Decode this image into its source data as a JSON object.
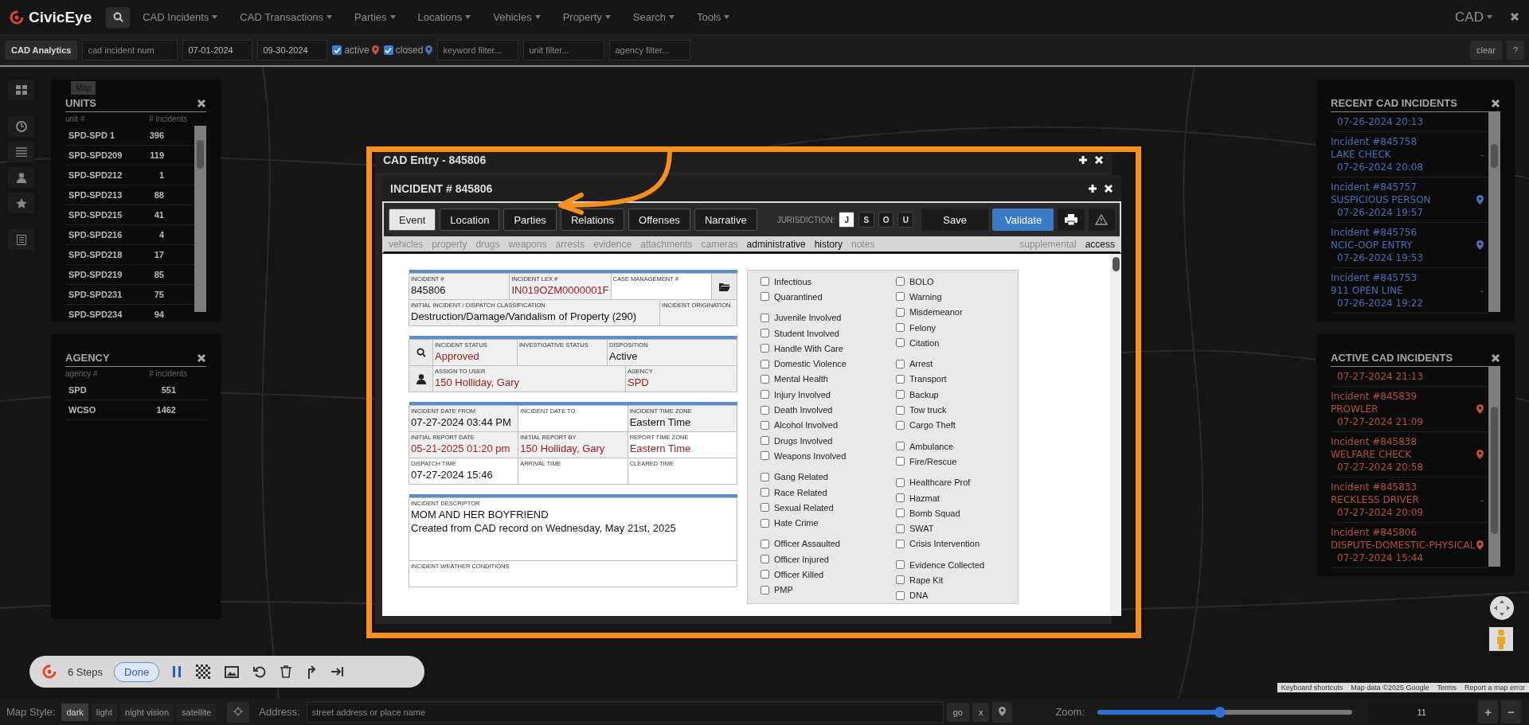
{
  "nav": {
    "logo": "CivicEye",
    "menus": [
      "CAD Incidents",
      "CAD Transactions",
      "Parties",
      "Locations",
      "Vehicles",
      "Property",
      "Search",
      "Tools"
    ],
    "right_menu": "CAD"
  },
  "filter_bar": {
    "title": "CAD Analytics",
    "incident_field": {
      "placeholder": "cad incident num"
    },
    "date_from": "07-01-2024",
    "date_to": "09-30-2024",
    "toggles": [
      {
        "label": "active",
        "checked": true,
        "color": "#c0503e"
      },
      {
        "label": "closed",
        "checked": true,
        "color": "#4a6fb5"
      }
    ],
    "filters": [
      {
        "placeholder": "keyword filter..."
      },
      {
        "placeholder": "unit filter..."
      },
      {
        "placeholder": "agency filter..."
      }
    ],
    "buttons": [
      "clear",
      "?"
    ]
  },
  "map": {
    "type_button": "Map",
    "attribution": [
      "Keyboard shortcuts",
      "Map data ©2025 Google",
      "Terms",
      "Report a map error"
    ]
  },
  "units_panel": {
    "title": "UNITS",
    "columns": [
      "unit #",
      "# incidents"
    ],
    "rows": [
      {
        "name": "SPD-SPD 1",
        "count": "396"
      },
      {
        "name": "SPD-SPD209",
        "count": "119"
      },
      {
        "name": "SPD-SPD212",
        "count": "1"
      },
      {
        "name": "SPD-SPD213",
        "count": "88"
      },
      {
        "name": "SPD-SPD215",
        "count": "41"
      },
      {
        "name": "SPD-SPD216",
        "count": "4"
      },
      {
        "name": "SPD-SPD218",
        "count": "17"
      },
      {
        "name": "SPD-SPD219",
        "count": "85"
      },
      {
        "name": "SPD-SPD231",
        "count": "75"
      },
      {
        "name": "SPD-SPD234",
        "count": "94"
      }
    ]
  },
  "agency_panel": {
    "title": "AGENCY",
    "columns": [
      "agency #",
      "# incidents"
    ],
    "rows": [
      {
        "name": "SPD",
        "count": "551"
      },
      {
        "name": "WCSO",
        "count": "1462"
      }
    ]
  },
  "incident_panels": [
    {
      "title": "RECENT CAD INCIDENTS",
      "kind": "recent",
      "top_date": "07-26-2024 20:13",
      "items": [
        {
          "number": "Incident #845758",
          "type": "LAKE CHECK",
          "date": "07-26-2024 20:08",
          "pinned": false,
          "marker": "-"
        },
        {
          "number": "Incident #845757",
          "type": "SUSPICIOUS PERSON",
          "date": "07-26-2024 19:57",
          "pinned": true
        },
        {
          "number": "Incident #845756",
          "type": "NCIC-OOP ENTRY",
          "date": "07-26-2024 19:53",
          "pinned": true
        },
        {
          "number": "Incident #845753",
          "type": "911 OPEN LINE",
          "date": "07-26-2024 19:22",
          "pinned": false,
          "marker": "-"
        }
      ]
    },
    {
      "title": "ACTIVE CAD INCIDENTS",
      "kind": "active",
      "top_date": "07-27-2024 21:13",
      "items": [
        {
          "number": "Incident #845839",
          "type": "PROWLER",
          "date": "07-27-2024 21:09",
          "pinned": true
        },
        {
          "number": "Incident #845838",
          "type": "WELFARE CHECK",
          "date": "07-27-2024 20:58",
          "pinned": true
        },
        {
          "number": "Incident #845833",
          "type": "RECKLESS DRIVER",
          "date": "07-27-2024 20:09",
          "pinned": false,
          "marker": "-"
        },
        {
          "number": "Incident #845806",
          "type": "DISPUTE-DOMESTIC-PHYSICAL",
          "date": "07-27-2024 15:44",
          "pinned": true
        }
      ]
    }
  ],
  "cad_entry": {
    "title": "CAD Entry - 845806"
  },
  "incident": {
    "title": "INCIDENT # 845806",
    "tabs": [
      {
        "label": "Event",
        "selected": true
      },
      {
        "label": "Location",
        "selected": false
      },
      {
        "label": "Parties",
        "selected": false
      },
      {
        "label": "Relations",
        "selected": false
      },
      {
        "label": "Offenses",
        "selected": false
      },
      {
        "label": "Narrative",
        "selected": false
      }
    ],
    "jurisdiction": {
      "label": "JURISDICTION:",
      "options": [
        {
          "label": "J",
          "selected": true
        },
        {
          "label": "S",
          "selected": false
        },
        {
          "label": "O",
          "selected": false
        },
        {
          "label": "U",
          "selected": false
        }
      ]
    },
    "actions": [
      {
        "label": "Save",
        "kind": "plain"
      },
      {
        "label": "Validate",
        "kind": "primary"
      }
    ],
    "links": [
      {
        "label": "vehicles",
        "enabled": false
      },
      {
        "label": "property",
        "enabled": false
      },
      {
        "label": "drugs",
        "enabled": false
      },
      {
        "label": "weapons",
        "enabled": false
      },
      {
        "label": "arrests",
        "enabled": false
      },
      {
        "label": "evidence",
        "enabled": false
      },
      {
        "label": "attachments",
        "enabled": false
      },
      {
        "label": "cameras",
        "enabled": false
      },
      {
        "label": "administrative",
        "enabled": true
      },
      {
        "label": "history",
        "enabled": true
      },
      {
        "label": "notes",
        "enabled": false
      },
      {
        "label": "supplemental",
        "enabled": false
      },
      {
        "label": "access",
        "enabled": true
      }
    ],
    "sections": [
      {
        "rows": [
          {
            "fields": [
              {
                "label": "INCIDENT #",
                "value": "845806",
                "flagged": false,
                "shaded": true
              },
              {
                "label": "INCIDENT LEX #",
                "value": "IN019OZM0000001F",
                "flagged": true,
                "shaded": true
              },
              {
                "label": "CASE MANAGEMENT #",
                "shaded": false
              }
            ]
          },
          {
            "fields": [
              {
                "label": "INITIAL INCIDENT / DISPATCH CLASSIFICATION",
                "value": "Destruction/Damage/Vandalism of Property (290)",
                "flagged": false,
                "shaded": true
              },
              {
                "label": "INCIDENT ORIGINATION",
                "shaded": true
              }
            ]
          }
        ]
      },
      {
        "rows": [
          {
            "fields": [
              {
                "label": "INCIDENT STATUS",
                "value": "Approved",
                "flagged": true,
                "shaded": true
              },
              {
                "label": "INVESTIGATIVE STATUS",
                "shaded": true
              },
              {
                "label": "DISPOSITION",
                "value": "Active",
                "flagged": false,
                "shaded": true
              }
            ]
          },
          {
            "fields": [
              {
                "label": "ASSIGN TO USER",
                "value": "150 Holliday, Gary",
                "flagged": true,
                "shaded": true
              },
              {
                "label": "AGENCY",
                "value": "SPD",
                "flagged": true,
                "shaded": true
              }
            ]
          }
        ]
      },
      {
        "rows": [
          {
            "fields": [
              {
                "label": "INCIDENT DATE FROM",
                "value": "07-27-2024 03:44 PM",
                "flagged": false,
                "shaded": true
              },
              {
                "label": "INCIDENT DATE TO",
                "shaded": false
              },
              {
                "label": "INCIDENT TIME ZONE",
                "value": "Eastern Time",
                "flagged": false,
                "shaded": true
              }
            ]
          },
          {
            "fields": [
              {
                "label": "INITIAL REPORT DATE",
                "value": "05-21-2025 01:20 pm",
                "flagged": true,
                "shaded": true
              },
              {
                "label": "INITIAL REPORT BY",
                "value": "150 Holliday, Gary",
                "flagged": true,
                "shaded": true
              },
              {
                "label": "REPORT TIME ZONE",
                "value": "Eastern Time",
                "flagged": true,
                "shaded": false
              }
            ]
          },
          {
            "fields": [
              {
                "label": "DISPATCH TIME",
                "value": "07-27-2024 15:46",
                "flagged": false,
                "shaded": false
              },
              {
                "label": "ARRIVAL TIME",
                "shaded": false
              },
              {
                "label": "CLEARED TIME",
                "shaded": false
              }
            ]
          }
        ]
      },
      {
        "rows": [
          {
            "fields": [
              {
                "label": "INCIDENT DESCRIPTOR",
                "lines": [
                  "MOM AND HER BOYFRIEND",
                  "Created from CAD record on Wednesday, May 21st, 2025"
                ],
                "flagged": false,
                "shaded": false
              }
            ]
          },
          {
            "fields": [
              {
                "label": "INCIDENT WEATHER CONDITIONS",
                "shaded": false
              }
            ]
          }
        ]
      }
    ],
    "flags": {
      "columns": [
        [
          [
            {
              "label": "Infectious",
              "checked": false
            },
            {
              "label": "Quarantined",
              "checked": false
            }
          ],
          [
            {
              "label": "Juvenile Involved",
              "checked": false
            },
            {
              "label": "Student Involved",
              "checked": false
            },
            {
              "label": "Handle With Care",
              "checked": false
            },
            {
              "label": "Domestic Violence",
              "checked": false
            },
            {
              "label": "Mental Health",
              "checked": false
            },
            {
              "label": "Injury Involved",
              "checked": false
            },
            {
              "label": "Death Involved",
              "checked": false
            },
            {
              "label": "Alcohol Involved",
              "checked": false
            },
            {
              "label": "Drugs Involved",
              "checked": false
            },
            {
              "label": "Weapons Involved",
              "checked": false
            }
          ],
          [
            {
              "label": "Gang Related",
              "checked": false
            },
            {
              "label": "Race Related",
              "checked": false
            },
            {
              "label": "Sexual Related",
              "checked": false
            },
            {
              "label": "Hate Crime",
              "checked": false
            }
          ],
          [
            {
              "label": "Officer Assaulted",
              "checked": false
            },
            {
              "label": "Officer Injured",
              "checked": false
            },
            {
              "label": "Officer Killed",
              "checked": false
            },
            {
              "label": "PMP",
              "checked": false
            }
          ]
        ],
        [
          [
            {
              "label": "BOLO",
              "checked": false
            },
            {
              "label": "Warning",
              "checked": false
            },
            {
              "label": "Misdemeanor",
              "checked": false
            },
            {
              "label": "Felony",
              "checked": false
            },
            {
              "label": "Citation",
              "checked": false
            }
          ],
          [
            {
              "label": "Arrest",
              "checked": false
            },
            {
              "label": "Transport",
              "checked": false
            },
            {
              "label": "Backup",
              "checked": false
            },
            {
              "label": "Tow truck",
              "checked": false
            },
            {
              "label": "Cargo Theft",
              "checked": false
            }
          ],
          [
            {
              "label": "Ambulance",
              "checked": false
            },
            {
              "label": "Fire/Rescue",
              "checked": false
            }
          ],
          [
            {
              "label": "Healthcare Prof",
              "checked": false
            },
            {
              "label": "Hazmat",
              "checked": false
            },
            {
              "label": "Bomb Squad",
              "checked": false
            },
            {
              "label": "SWAT",
              "checked": false
            },
            {
              "label": "Crisis Intervention",
              "checked": false
            }
          ],
          [
            {
              "label": "Evidence Collected",
              "checked": false
            },
            {
              "label": "Rape Kit",
              "checked": false
            },
            {
              "label": "DNA",
              "checked": false
            }
          ]
        ]
      ]
    }
  },
  "steps_bar": {
    "count": "6 Steps",
    "done": "Done"
  },
  "bottom_bar": {
    "style_label": "Map Style:",
    "styles": [
      {
        "label": "dark",
        "selected": true
      },
      {
        "label": "light",
        "selected": false
      },
      {
        "label": "night vision",
        "selected": false
      },
      {
        "label": "satellite",
        "selected": false
      }
    ],
    "address_label": "Address:",
    "address": {
      "placeholder": "street address or place name"
    },
    "buttons": [
      "go",
      "x"
    ],
    "zoom_label": "Zoom:",
    "zoom": {
      "level": 0.48,
      "value": "11"
    },
    "zoom_buttons": [
      "+",
      "−"
    ]
  }
}
